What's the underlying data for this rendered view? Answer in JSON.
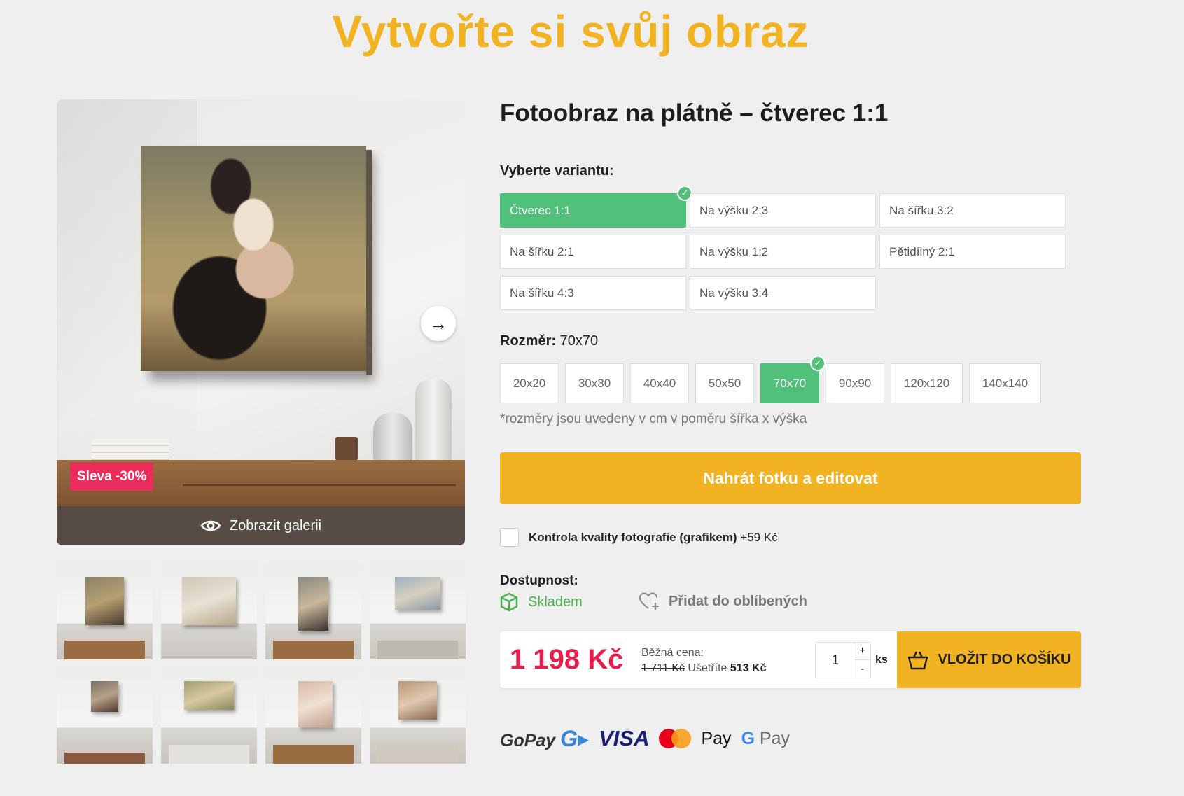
{
  "page": {
    "title": "Vytvořte si svůj obraz"
  },
  "product": {
    "title": "Fotoobraz na plátně – čtverec 1:1",
    "badge": "Sleva -30%",
    "gallery_label": "Zobrazit galerii"
  },
  "variants": {
    "label": "Vyberte variantu:",
    "items": [
      {
        "label": "Čtverec 1:1",
        "selected": true
      },
      {
        "label": "Na výšku 2:3",
        "selected": false
      },
      {
        "label": "Na šířku 3:2",
        "selected": false
      },
      {
        "label": "Na šířku 2:1",
        "selected": false
      },
      {
        "label": "Na výšku 1:2",
        "selected": false
      },
      {
        "label": "Pětidílný 2:1",
        "selected": false
      },
      {
        "label": "Na šířku 4:3",
        "selected": false
      },
      {
        "label": "Na výšku 3:4",
        "selected": false
      }
    ]
  },
  "sizes": {
    "label": "Rozměr:",
    "current": "70x70",
    "items": [
      {
        "label": "20x20",
        "selected": false
      },
      {
        "label": "30x30",
        "selected": false
      },
      {
        "label": "40x40",
        "selected": false
      },
      {
        "label": "50x50",
        "selected": false
      },
      {
        "label": "70x70",
        "selected": true
      },
      {
        "label": "90x90",
        "selected": false
      },
      {
        "label": "120x120",
        "selected": false
      },
      {
        "label": "140x140",
        "selected": false
      }
    ],
    "note": "*rozměry jsou uvedeny v cm v poměru šířka x výška"
  },
  "upload_button": "Nahrát fotku a editovat",
  "quality_check": {
    "label": "Kontrola kvality fotografie (grafikem)",
    "price": "+59 Kč",
    "checked": false
  },
  "availability": {
    "label": "Dostupnost:",
    "status": "Skladem"
  },
  "favorite": "Přidat do oblíbených",
  "pricing": {
    "price": "1 198 Kč",
    "regular_label": "Běžná cena:",
    "regular_price": "1 711 Kč",
    "save_label": "Ušetříte",
    "save_amount": "513 Kč"
  },
  "quantity": {
    "value": "1",
    "plus": "+",
    "minus": "-",
    "unit": "ks"
  },
  "cart_button": "VLOŽIT DO KOŠÍKU",
  "payments": {
    "gopay": "GoPay",
    "gopay_mark": "G▸",
    "visa": "VISA",
    "applepay": "Pay",
    "apple_glyph": "",
    "googlepay": "Pay",
    "google_g": "G"
  },
  "colors": {
    "accent": "#f2b322",
    "green": "#50c07a",
    "price_red": "#e91e4d",
    "badge_pink": "#ea2d5a"
  }
}
